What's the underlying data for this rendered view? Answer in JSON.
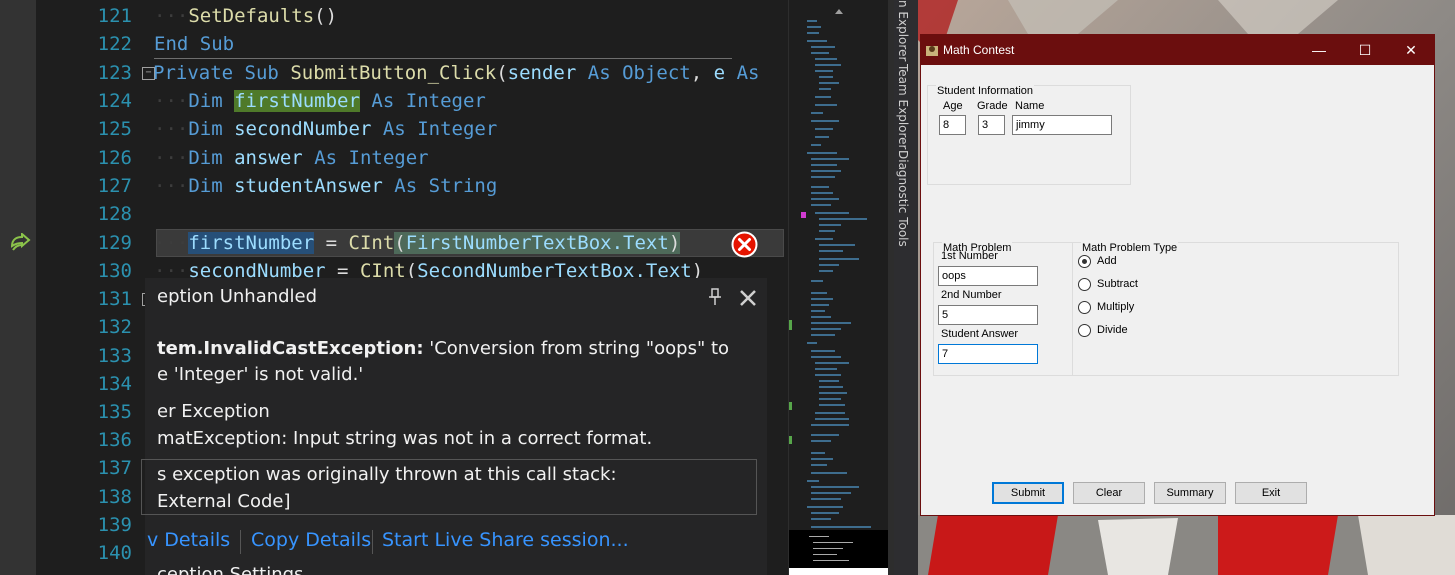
{
  "editor": {
    "line_numbers": [
      "121",
      "122",
      "123",
      "124",
      "125",
      "126",
      "127",
      "128",
      "129",
      "130",
      "131",
      "132",
      "133",
      "134",
      "135",
      "136",
      "137",
      "138",
      "139",
      "140"
    ],
    "code": {
      "l121_fn": "SetDefaults",
      "l121_paren": "()",
      "l122_end": "End",
      "l122_sub": "Sub",
      "l123_private": "Private",
      "l123_sub": "Sub",
      "l123_name": "SubmitButton_Click",
      "l123_open": "(",
      "l123_sender": "sender",
      "l123_as1": "As",
      "l123_object": "Object",
      "l123_comma": ",",
      "l123_e": "e",
      "l123_as2": "As",
      "dim": "Dim",
      "as": "As",
      "integer": "Integer",
      "string": "String",
      "firstNumber": "firstNumber",
      "secondNumber": "secondNumber",
      "answer": "answer",
      "studentAnswer": "studentAnswer",
      "l129_eq": " = ",
      "cint": "CInt",
      "l129_arg": "FirstNumberTextBox.Text",
      "l130_arg": "SecondNumberTextBox.Text",
      "open": "(",
      "close": ")"
    }
  },
  "exception": {
    "title": "eption Unhandled",
    "type": "tem.InvalidCastException:",
    "message1": " 'Conversion from string \"oops\" to",
    "message2": "e 'Integer' is not valid.'",
    "inner_title": "er Exception",
    "inner_message": "matException: Input string was not in a correct format.",
    "stack_line1": "s exception was originally thrown at this call stack:",
    "stack_line2": "External Code]",
    "link_view": "v Details",
    "link_copy": "Copy Details",
    "link_live": "Start Live Share session...",
    "settings": "ception Settings"
  },
  "side_tabs": [
    "n Explorer",
    "Team Explorer",
    "Diagnostic Tools"
  ],
  "window": {
    "title": "Math Contest",
    "controls": {
      "minimize": "—",
      "maximize": "☐",
      "close": "✕"
    },
    "student_group": "Student Information",
    "age_label": "Age",
    "grade_label": "Grade",
    "name_label": "Name",
    "age_value": "8",
    "grade_value": "3",
    "name_value": "jimmy",
    "problem_group": "Math Problem",
    "first_label": "1st Number",
    "first_value": "oops",
    "second_label": "2nd Number",
    "second_value": "5",
    "answer_label": "Student Answer",
    "answer_value": "7",
    "type_group": "Math Problem Type",
    "types": [
      "Add",
      "Subtract",
      "Multiply",
      "Divide"
    ],
    "selected_type": "Add",
    "buttons": {
      "submit": "Submit",
      "clear": "Clear",
      "summary": "Summary",
      "exit": "Exit"
    }
  },
  "colors": {
    "keyword": "#569cd6",
    "function": "#dcdcaa",
    "type": "#4ec9b0",
    "identifier": "#9cdcfe",
    "line_number": "#2b91af",
    "link": "#3794ff",
    "title_bar": "#6b0e0e"
  }
}
